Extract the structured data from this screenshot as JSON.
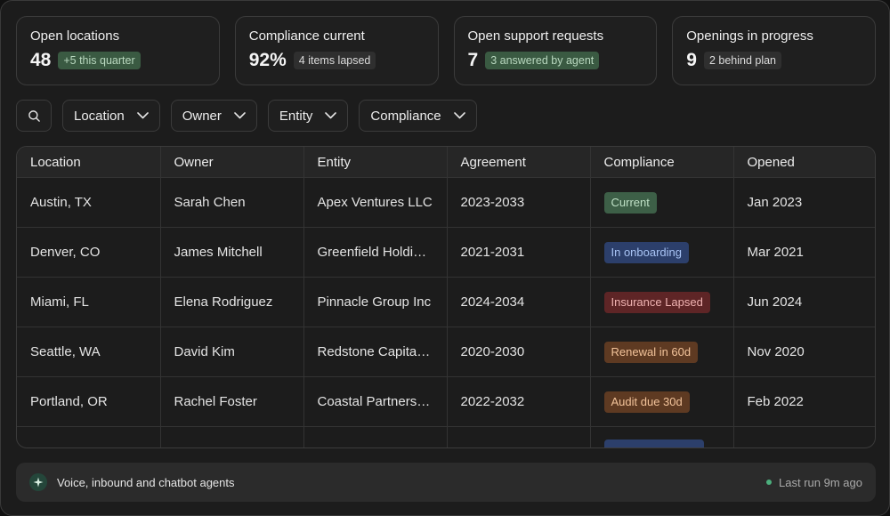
{
  "stats": [
    {
      "label": "Open locations",
      "value": "48",
      "badge": "+5 this quarter",
      "badge_tone": "green"
    },
    {
      "label": "Compliance current",
      "value": "92%",
      "badge": "4 items lapsed",
      "badge_tone": "grey"
    },
    {
      "label": "Open support requests",
      "value": "7",
      "badge": "3 answered by agent",
      "badge_tone": "green"
    },
    {
      "label": "Openings in progress",
      "value": "9",
      "badge": "2 behind plan",
      "badge_tone": "grey"
    }
  ],
  "filters": {
    "search_icon": "search-icon",
    "items": [
      "Location",
      "Owner",
      "Entity",
      "Compliance"
    ]
  },
  "table": {
    "columns": [
      "Location",
      "Owner",
      "Entity",
      "Agreement",
      "Compliance",
      "Opened"
    ],
    "rows": [
      {
        "location": "Austin, TX",
        "owner": "Sarah Chen",
        "entity": "Apex Ventures LLC",
        "agreement": "2023-2033",
        "compliance": "Current",
        "compliance_bg": "#3d5f47",
        "compliance_fg": "#bfe0c6",
        "opened": "Jan 2023"
      },
      {
        "location": "Denver, CO",
        "owner": "James Mitchell",
        "entity": "Greenfield Holdings",
        "agreement": "2021-2031",
        "compliance": "In onboarding",
        "compliance_bg": "#2c3f6b",
        "compliance_fg": "#a9c4f5",
        "opened": "Mar 2021"
      },
      {
        "location": "Miami, FL",
        "owner": "Elena Rodriguez",
        "entity": "Pinnacle Group Inc",
        "agreement": "2024-2034",
        "compliance": "Insurance Lapsed",
        "compliance_bg": "#5e2526",
        "compliance_fg": "#f0b3b2",
        "opened": "Jun 2024"
      },
      {
        "location": "Seattle, WA",
        "owner": "David Kim",
        "entity": "Redstone Capital Partners",
        "agreement": "2020-2030",
        "compliance": "Renewal in 60d",
        "compliance_bg": "#5e3a22",
        "compliance_fg": "#f2c39a",
        "opened": "Nov 2020"
      },
      {
        "location": "Portland, OR",
        "owner": "Rachel Foster",
        "entity": "Coastal Partners Group",
        "agreement": "2022-2032",
        "compliance": "Audit due 30d",
        "compliance_bg": "#5e3a22",
        "compliance_fg": "#f2c39a",
        "opened": "Feb 2022"
      },
      {
        "location": "",
        "owner": "",
        "entity": "",
        "agreement": "",
        "compliance": "",
        "compliance_bg": "#2c3f6b",
        "compliance_fg": "#a9c4f5",
        "opened": ""
      }
    ]
  },
  "footer": {
    "icon": "sparkle-icon",
    "label": "Voice, inbound and chatbot agents",
    "status": "Last run 9m ago",
    "status_color": "#4caf7d"
  }
}
